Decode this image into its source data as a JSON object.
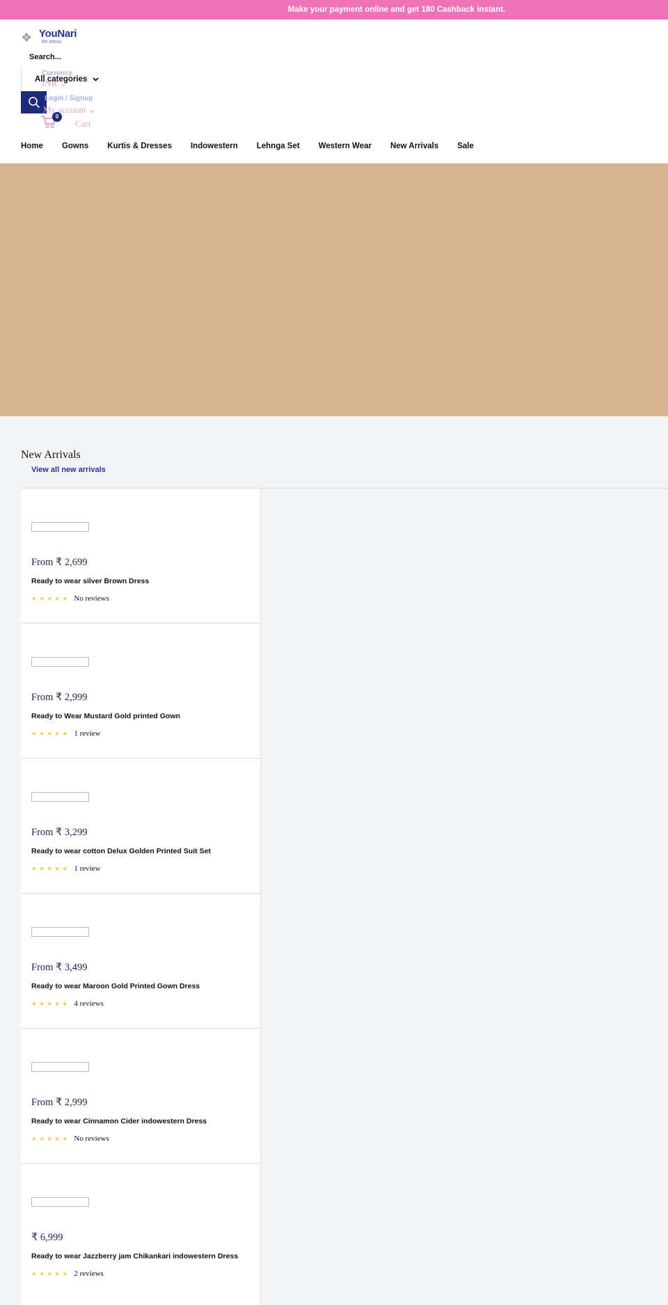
{
  "announcement": "Make your payment online and get 180 Cashback instant.",
  "logo": {
    "name": "YouNari",
    "tagline": "Be ethnic"
  },
  "search": {
    "placeholder": "Search...",
    "category": "All categories"
  },
  "currency": {
    "label": "Currency",
    "value": "INR"
  },
  "account": {
    "login": "Login / Signup",
    "label": "My account"
  },
  "cart": {
    "count": "0",
    "label": "Cart"
  },
  "nav": [
    "Home",
    "Gowns",
    "Kurtis & Dresses",
    "Indowestern",
    "Lehnga Set",
    "Western Wear",
    "New Arrivals",
    "Sale"
  ],
  "banner": {
    "color": "#d8b592"
  },
  "section": {
    "title": "New Arrivals",
    "view_all": "View all new arrivals"
  },
  "products": [
    {
      "price": "From ₹ 2,699",
      "name": "Ready to wear silver Brown Dress",
      "stars": "★★★★★",
      "reviews": "No reviews"
    },
    {
      "price": "From ₹ 2,999",
      "name": "Ready to Wear Mustard Gold printed Gown",
      "stars": "★★★★★",
      "reviews": "1 review"
    },
    {
      "price": "From ₹ 3,299",
      "name": "Ready to wear cotton Delux Golden Printed Suit Set",
      "stars": "★★★★★",
      "reviews": "1 review"
    },
    {
      "price": "From ₹ 3,499",
      "name": "Ready to wear Maroon Gold Printed Gown Dress",
      "stars": "★★★★★",
      "reviews": "4 reviews"
    },
    {
      "price": "From ₹ 2,999",
      "name": "Ready to wear Cinnamon Cider indowestern Dress",
      "stars": "★★★★★",
      "reviews": "No reviews"
    },
    {
      "price": "₹ 6,999",
      "name": "Ready to wear Jazzberry jam Chikankari indowestern Dress",
      "stars": "★★★★★",
      "reviews": "2 reviews"
    }
  ]
}
